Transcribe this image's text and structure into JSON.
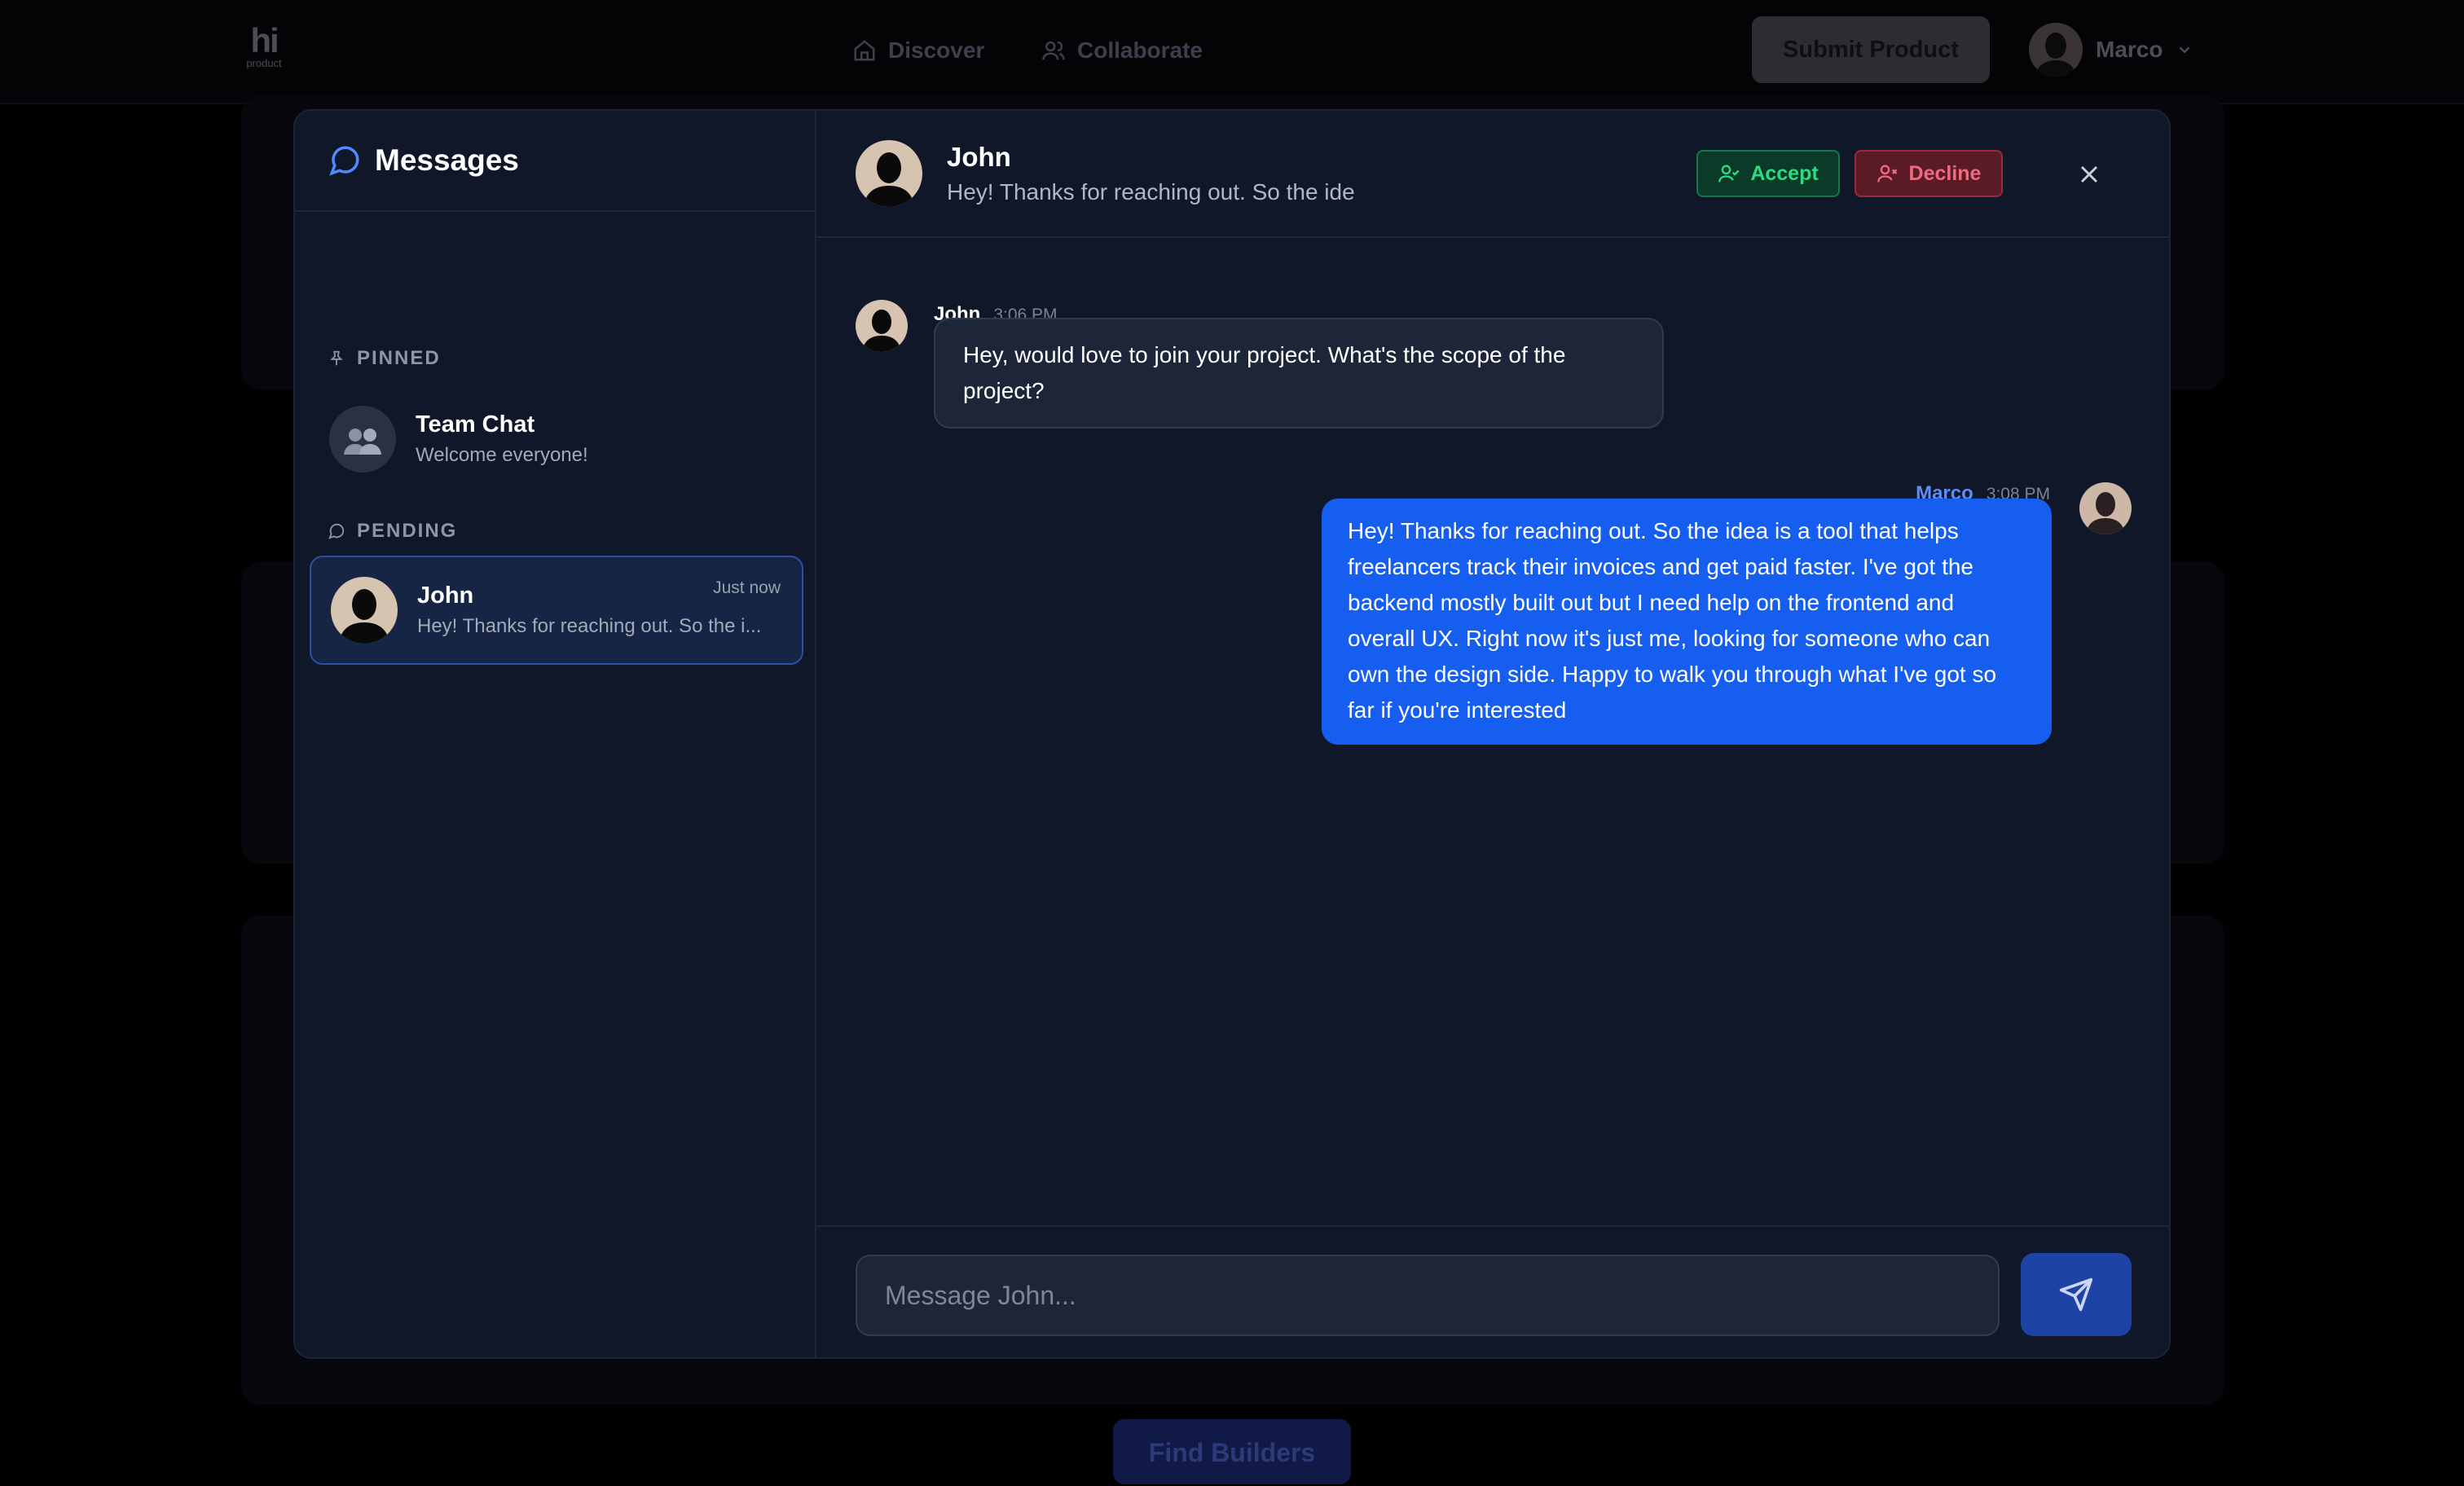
{
  "topbar": {
    "logo": {
      "main": "hi",
      "sub": "product"
    },
    "nav": [
      {
        "label": "Discover",
        "icon": "home-icon"
      },
      {
        "label": "Collaborate",
        "icon": "users-icon"
      }
    ],
    "submit_label": "Submit Product",
    "user_name": "Marco"
  },
  "background": {
    "find_builders_label": "Find Builders"
  },
  "messages_panel": {
    "title": "Messages",
    "pinned_label": "PINNED",
    "pending_label": "PENDING",
    "pinned": [
      {
        "name": "Team Chat",
        "preview": "Welcome everyone!"
      }
    ],
    "pending": [
      {
        "name": "John",
        "preview": "Hey! Thanks for reaching out. So the i...",
        "time": "Just now"
      }
    ]
  },
  "chat": {
    "header": {
      "name": "John",
      "subtitle": "Hey! Thanks for reaching out. So the ide",
      "accept_label": "Accept",
      "decline_label": "Decline"
    },
    "messages": [
      {
        "sender": "John",
        "time": "3:06 PM",
        "text": "Hey, would love to join your project. What's the scope of the project?"
      },
      {
        "sender": "Marco",
        "time": "3:08 PM",
        "text": "Hey! Thanks for reaching out. So the idea is a tool that helps freelancers track their invoices and get paid faster. I've got the backend mostly built out but I need help on the frontend and overall UX. Right now it's just me, looking for someone who can own the design side. Happy to walk you through what I've got so far if you're interested"
      }
    ],
    "composer": {
      "placeholder": "Message John...",
      "value": ""
    }
  },
  "colors": {
    "accent": "#155eef",
    "accept": "#2ddc7e",
    "decline": "#f06b7d",
    "panel": "#0f1728"
  }
}
